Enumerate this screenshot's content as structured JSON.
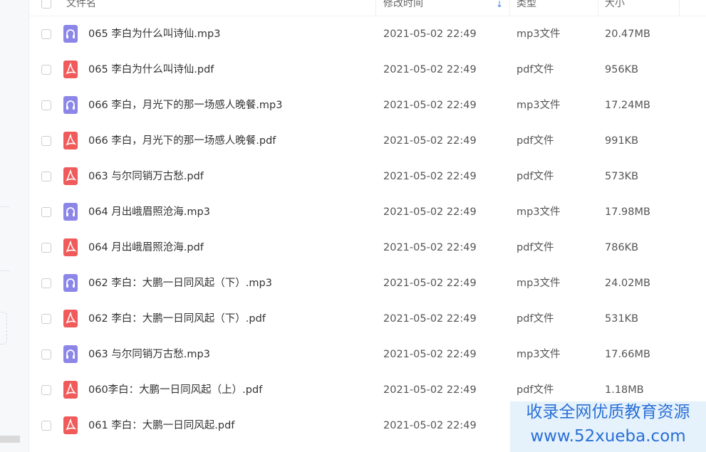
{
  "header": {
    "col_name": "文件名",
    "col_time": "修改时间",
    "col_type": "类型",
    "col_size": "大小",
    "sort_icon": "arrow-down-icon"
  },
  "icons": {
    "mp3": "headphones-icon",
    "pdf": "pdf-icon"
  },
  "colors": {
    "mp3_icon": "#8b86e8",
    "pdf_icon": "#f05a5a",
    "accent": "#3b82f6",
    "watermark": "#2a6fd6"
  },
  "files": [
    {
      "kind": "mp3",
      "name": "065 李白为什么叫诗仙.mp3",
      "time": "2021-05-02 22:49",
      "type": "mp3文件",
      "size": "20.47MB"
    },
    {
      "kind": "pdf",
      "name": "065 李白为什么叫诗仙.pdf",
      "time": "2021-05-02 22:49",
      "type": "pdf文件",
      "size": "956KB"
    },
    {
      "kind": "mp3",
      "name": "066 李白，月光下的那一场感人晚餐.mp3",
      "time": "2021-05-02 22:49",
      "type": "mp3文件",
      "size": "17.24MB"
    },
    {
      "kind": "pdf",
      "name": "066 李白，月光下的那一场感人晚餐.pdf",
      "time": "2021-05-02 22:49",
      "type": "pdf文件",
      "size": "991KB"
    },
    {
      "kind": "pdf",
      "name": "063 与尔同销万古愁.pdf",
      "time": "2021-05-02 22:49",
      "type": "pdf文件",
      "size": "573KB"
    },
    {
      "kind": "mp3",
      "name": "064 月出峨眉照沧海.mp3",
      "time": "2021-05-02 22:49",
      "type": "mp3文件",
      "size": "17.98MB"
    },
    {
      "kind": "pdf",
      "name": "064 月出峨眉照沧海.pdf",
      "time": "2021-05-02 22:49",
      "type": "pdf文件",
      "size": "786KB"
    },
    {
      "kind": "mp3",
      "name": "062 李白：大鹏一日同风起（下）.mp3",
      "time": "2021-05-02 22:49",
      "type": "mp3文件",
      "size": "24.02MB"
    },
    {
      "kind": "pdf",
      "name": "062 李白：大鹏一日同风起（下）.pdf",
      "time": "2021-05-02 22:49",
      "type": "pdf文件",
      "size": "531KB"
    },
    {
      "kind": "mp3",
      "name": "063 与尔同销万古愁.mp3",
      "time": "2021-05-02 22:49",
      "type": "mp3文件",
      "size": "17.66MB"
    },
    {
      "kind": "pdf",
      "name": "060李白：大鹏一日同风起（上）.pdf",
      "time": "2021-05-02 22:49",
      "type": "pdf文件",
      "size": "1.18MB"
    },
    {
      "kind": "pdf",
      "name": "061 李白：大鹏一日同风起.pdf",
      "time": "2021-05-02 22:49",
      "type": "",
      "size": ""
    }
  ],
  "watermark": {
    "line1": "收录全网优质教育资源",
    "line2": "www.52xueba.com"
  }
}
